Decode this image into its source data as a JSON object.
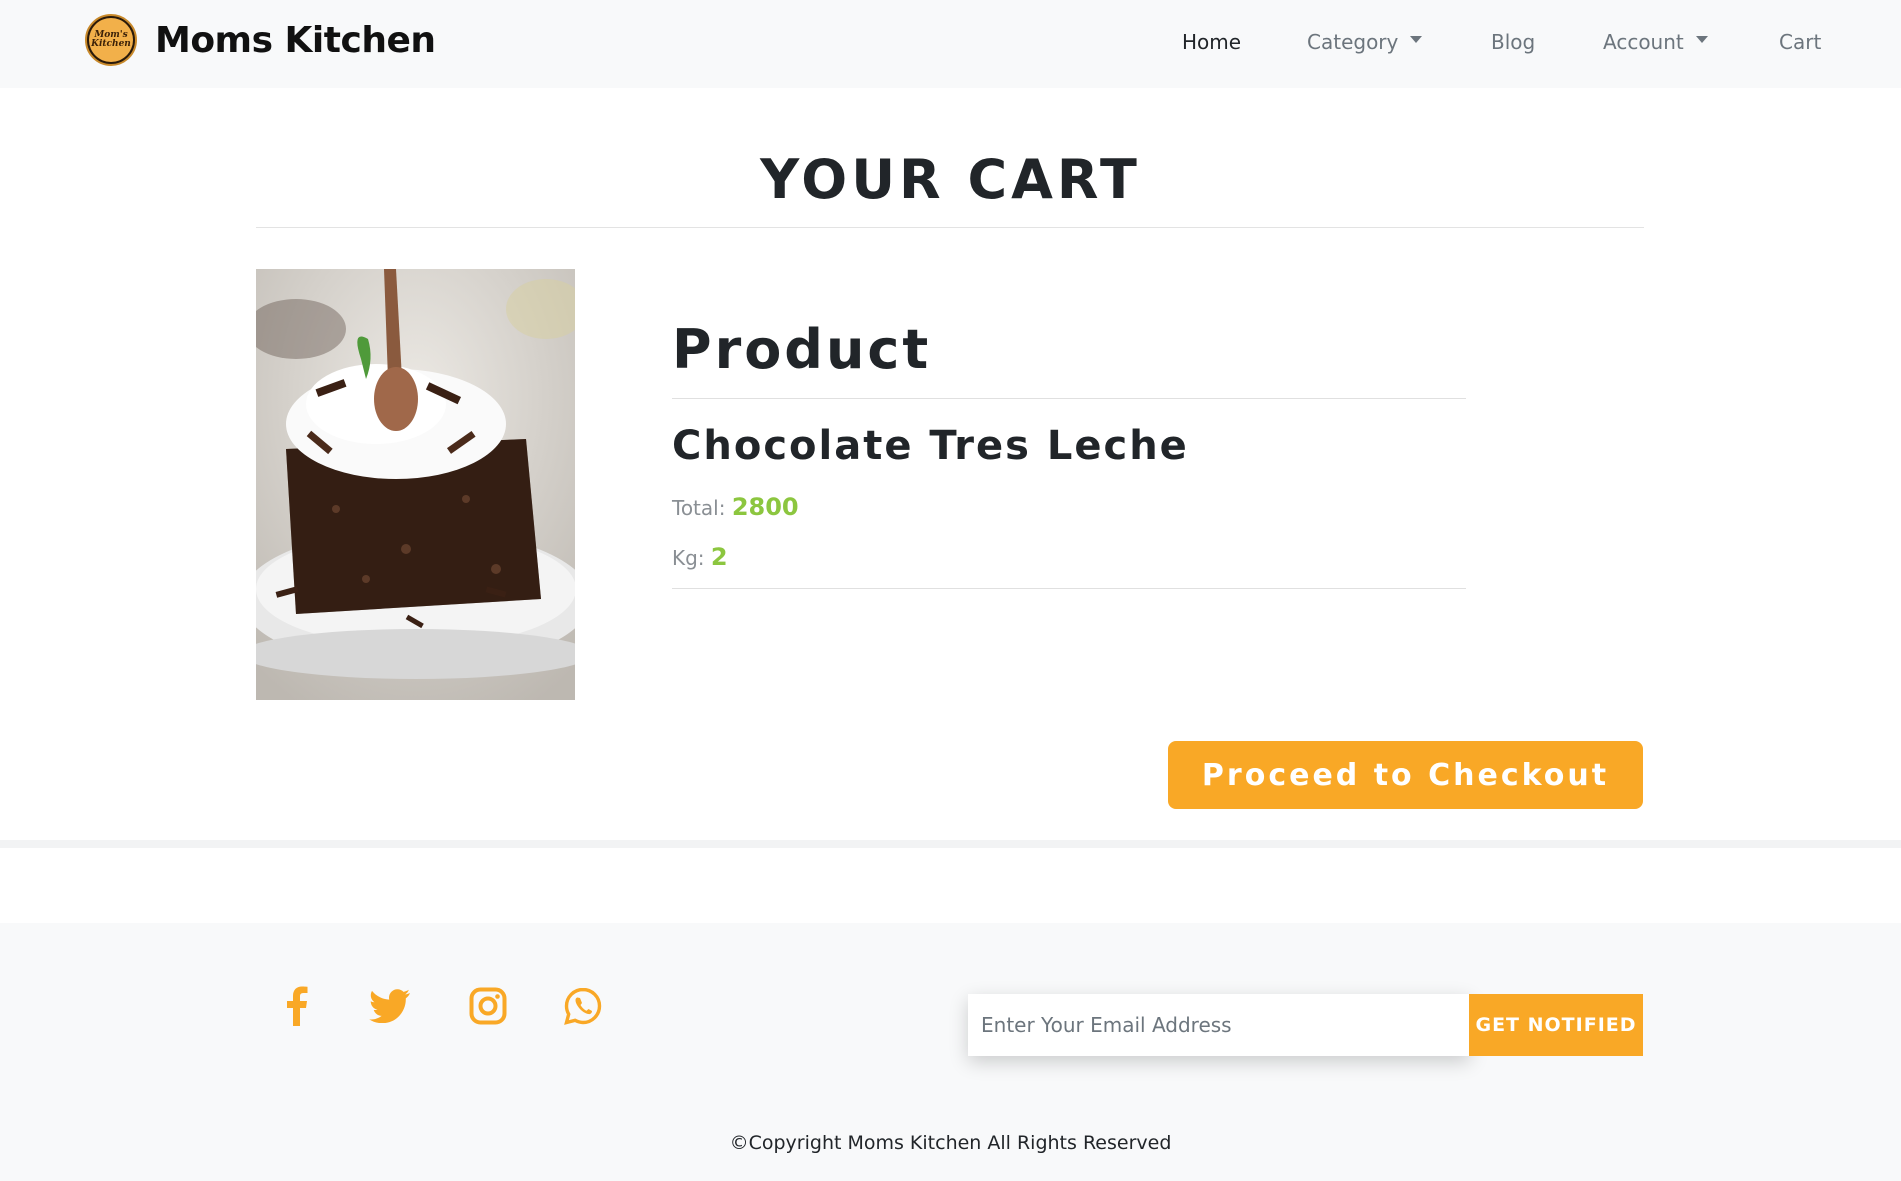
{
  "brand": {
    "name": "Moms Kitchen",
    "logo_text": "Mom's Kitchen"
  },
  "nav": {
    "home": "Home",
    "category": "Category",
    "blog": "Blog",
    "account": "Account",
    "cart": "Cart"
  },
  "cart": {
    "title": "YOUR CART",
    "product_heading": "Product",
    "item": {
      "name": "Chocolate Tres Leche",
      "total_label": "Total:",
      "total_value": "2800",
      "kg_label": "Kg:",
      "kg_value": "2"
    },
    "checkout_label": "Proceed to Checkout"
  },
  "footer": {
    "social_icons": [
      "facebook-icon",
      "twitter-icon",
      "instagram-icon",
      "whatsapp-icon"
    ],
    "email_placeholder": "Enter Your Email Address",
    "notify_label": "GET NOTIFIED",
    "copyright": "©Copyright Moms Kitchen All Rights Reserved"
  },
  "colors": {
    "accent": "#f9a826",
    "price_green": "#8cc63f",
    "navbar_bg": "#f8f9fa"
  }
}
